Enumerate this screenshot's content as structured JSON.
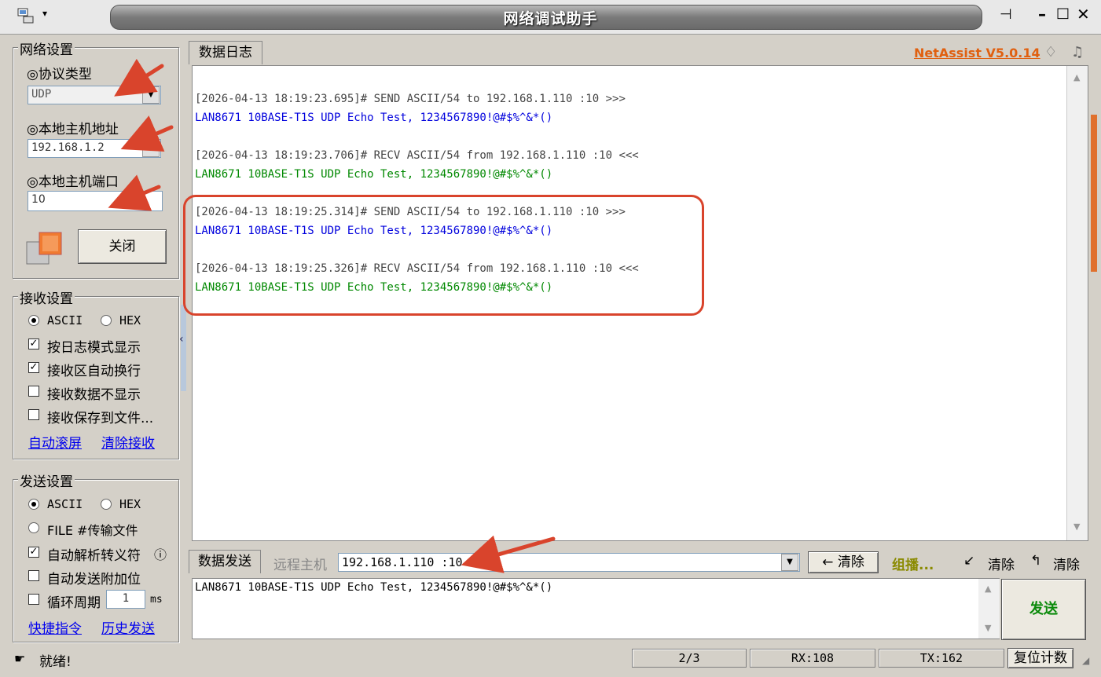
{
  "window": {
    "title": "网络调试助手",
    "menu_arrow": "▾",
    "pin_icon": "⊣",
    "min": "–",
    "max": "□",
    "close": "✕"
  },
  "network": {
    "group_title": "网络设置",
    "protocol_label": "◎协议类型",
    "protocol_value": "UDP",
    "host_label": "◎本地主机地址",
    "host_value": "192.168.1.2",
    "port_label": "◎本地主机端口",
    "port_value": "10",
    "close_button": "关闭"
  },
  "receive": {
    "group_title": "接收设置",
    "ascii": "ASCII",
    "hex": "HEX",
    "log_mode": "按日志模式显示",
    "auto_wrap": "接收区自动换行",
    "hide_data": "接收数据不显示",
    "save_file": "接收保存到文件...",
    "auto_scroll": "自动滚屏",
    "clear_recv": "清除接收"
  },
  "send": {
    "group_title": "发送设置",
    "ascii": "ASCII",
    "hex": "HEX",
    "file": "FILE #传输文件",
    "escape": "自动解析转义符",
    "append": "自动发送附加位",
    "loop": "循环周期",
    "loop_value": "1",
    "loop_unit": "ms",
    "shortcut": "快捷指令",
    "history": "历史发送",
    "info_icon": "ⓘ"
  },
  "log_tab": "数据日志",
  "brand": "NetAssist V5.0.14",
  "log": [
    {
      "type": "hdr",
      "text": "[2026-04-13 18:19:23.695]# SEND ASCII/54 to 192.168.1.110 :10 >>>"
    },
    {
      "type": "send",
      "text": "LAN8671 10BASE-T1S UDP Echo Test, 1234567890!@#$%^&*()"
    },
    {
      "type": "hdr",
      "text": "[2026-04-13 18:19:23.706]# RECV ASCII/54 from 192.168.1.110 :10 <<<"
    },
    {
      "type": "recv",
      "text": "LAN8671 10BASE-T1S UDP Echo Test, 1234567890!@#$%^&*()"
    },
    {
      "type": "hdr",
      "text": "[2026-04-13 18:19:25.314]# SEND ASCII/54 to 192.168.1.110 :10 >>>"
    },
    {
      "type": "send",
      "text": "LAN8671 10BASE-T1S UDP Echo Test, 1234567890!@#$%^&*()"
    },
    {
      "type": "hdr",
      "text": "[2026-04-13 18:19:25.326]# RECV ASCII/54 from 192.168.1.110 :10 <<<"
    },
    {
      "type": "recv",
      "text": "LAN8671 10BASE-T1S UDP Echo Test, 1234567890!@#$%^&*()"
    }
  ],
  "send_bar": {
    "tab": "数据发送",
    "remote_label": "远程主机",
    "remote_value": "192.168.1.110 :10",
    "clear_btn": "← 清除",
    "multicast": "组播...",
    "clear2": "清除",
    "clear3": "清除",
    "send_text": "LAN8671 10BASE-T1S UDP Echo Test, 1234567890!@#$%^&*()",
    "send_button": "发送"
  },
  "status": {
    "ready": "就绪!",
    "page": "2/3",
    "rx": "RX:108",
    "tx": "TX:162",
    "reset": "复位计数"
  },
  "colors": {
    "annotation": "#d9442c",
    "send": "#0000dd",
    "recv": "#008800",
    "brand": "#e06010"
  }
}
